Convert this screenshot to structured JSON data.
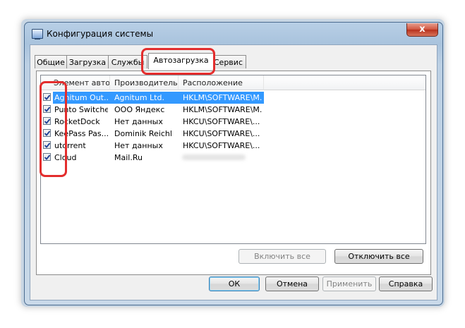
{
  "window": {
    "title": "Конфигурация системы",
    "close_glyph": "x"
  },
  "tabs": [
    {
      "label": "Общие"
    },
    {
      "label": "Загрузка"
    },
    {
      "label": "Службы"
    },
    {
      "label": "Автозагрузка"
    },
    {
      "label": "Сервис"
    }
  ],
  "active_tab": "Автозагрузка",
  "columns": [
    "Элемент авто...",
    "Производитель",
    "Расположение"
  ],
  "rows": [
    {
      "item": "Agnitum Out...",
      "maker": "Agnitum Ltd.",
      "location": "HKLM\\SOFTWARE\\M...",
      "checked": true,
      "selected": true
    },
    {
      "item": "Punto Switcher",
      "maker": "ООО Яндекс",
      "location": "HKLM\\SOFTWARE\\M...",
      "checked": true,
      "selected": false
    },
    {
      "item": "RocketDock",
      "maker": "Нет данных",
      "location": "HKCU\\SOFTWARE\\...",
      "checked": true,
      "selected": false
    },
    {
      "item": "KeePass Pas...",
      "maker": "Dominik Reichl",
      "location": "HKCU\\SOFTWARE\\...",
      "checked": true,
      "selected": false
    },
    {
      "item": "utorrent",
      "maker": "Нет данных",
      "location": "HKCU\\SOFTWARE\\...",
      "checked": true,
      "selected": false
    },
    {
      "item": "Cloud",
      "maker": "Mail.Ru",
      "location": "",
      "checked": true,
      "selected": false
    }
  ],
  "panel_buttons": {
    "enable_all": "Включить все",
    "disable_all": "Отключить все"
  },
  "dialog_buttons": {
    "ok": "ОК",
    "cancel": "Отмена",
    "apply": "Применить",
    "help": "Справка"
  },
  "colors": {
    "highlight": "#e32d2d",
    "selection": "#3399ff",
    "check": "#1c3f94"
  }
}
